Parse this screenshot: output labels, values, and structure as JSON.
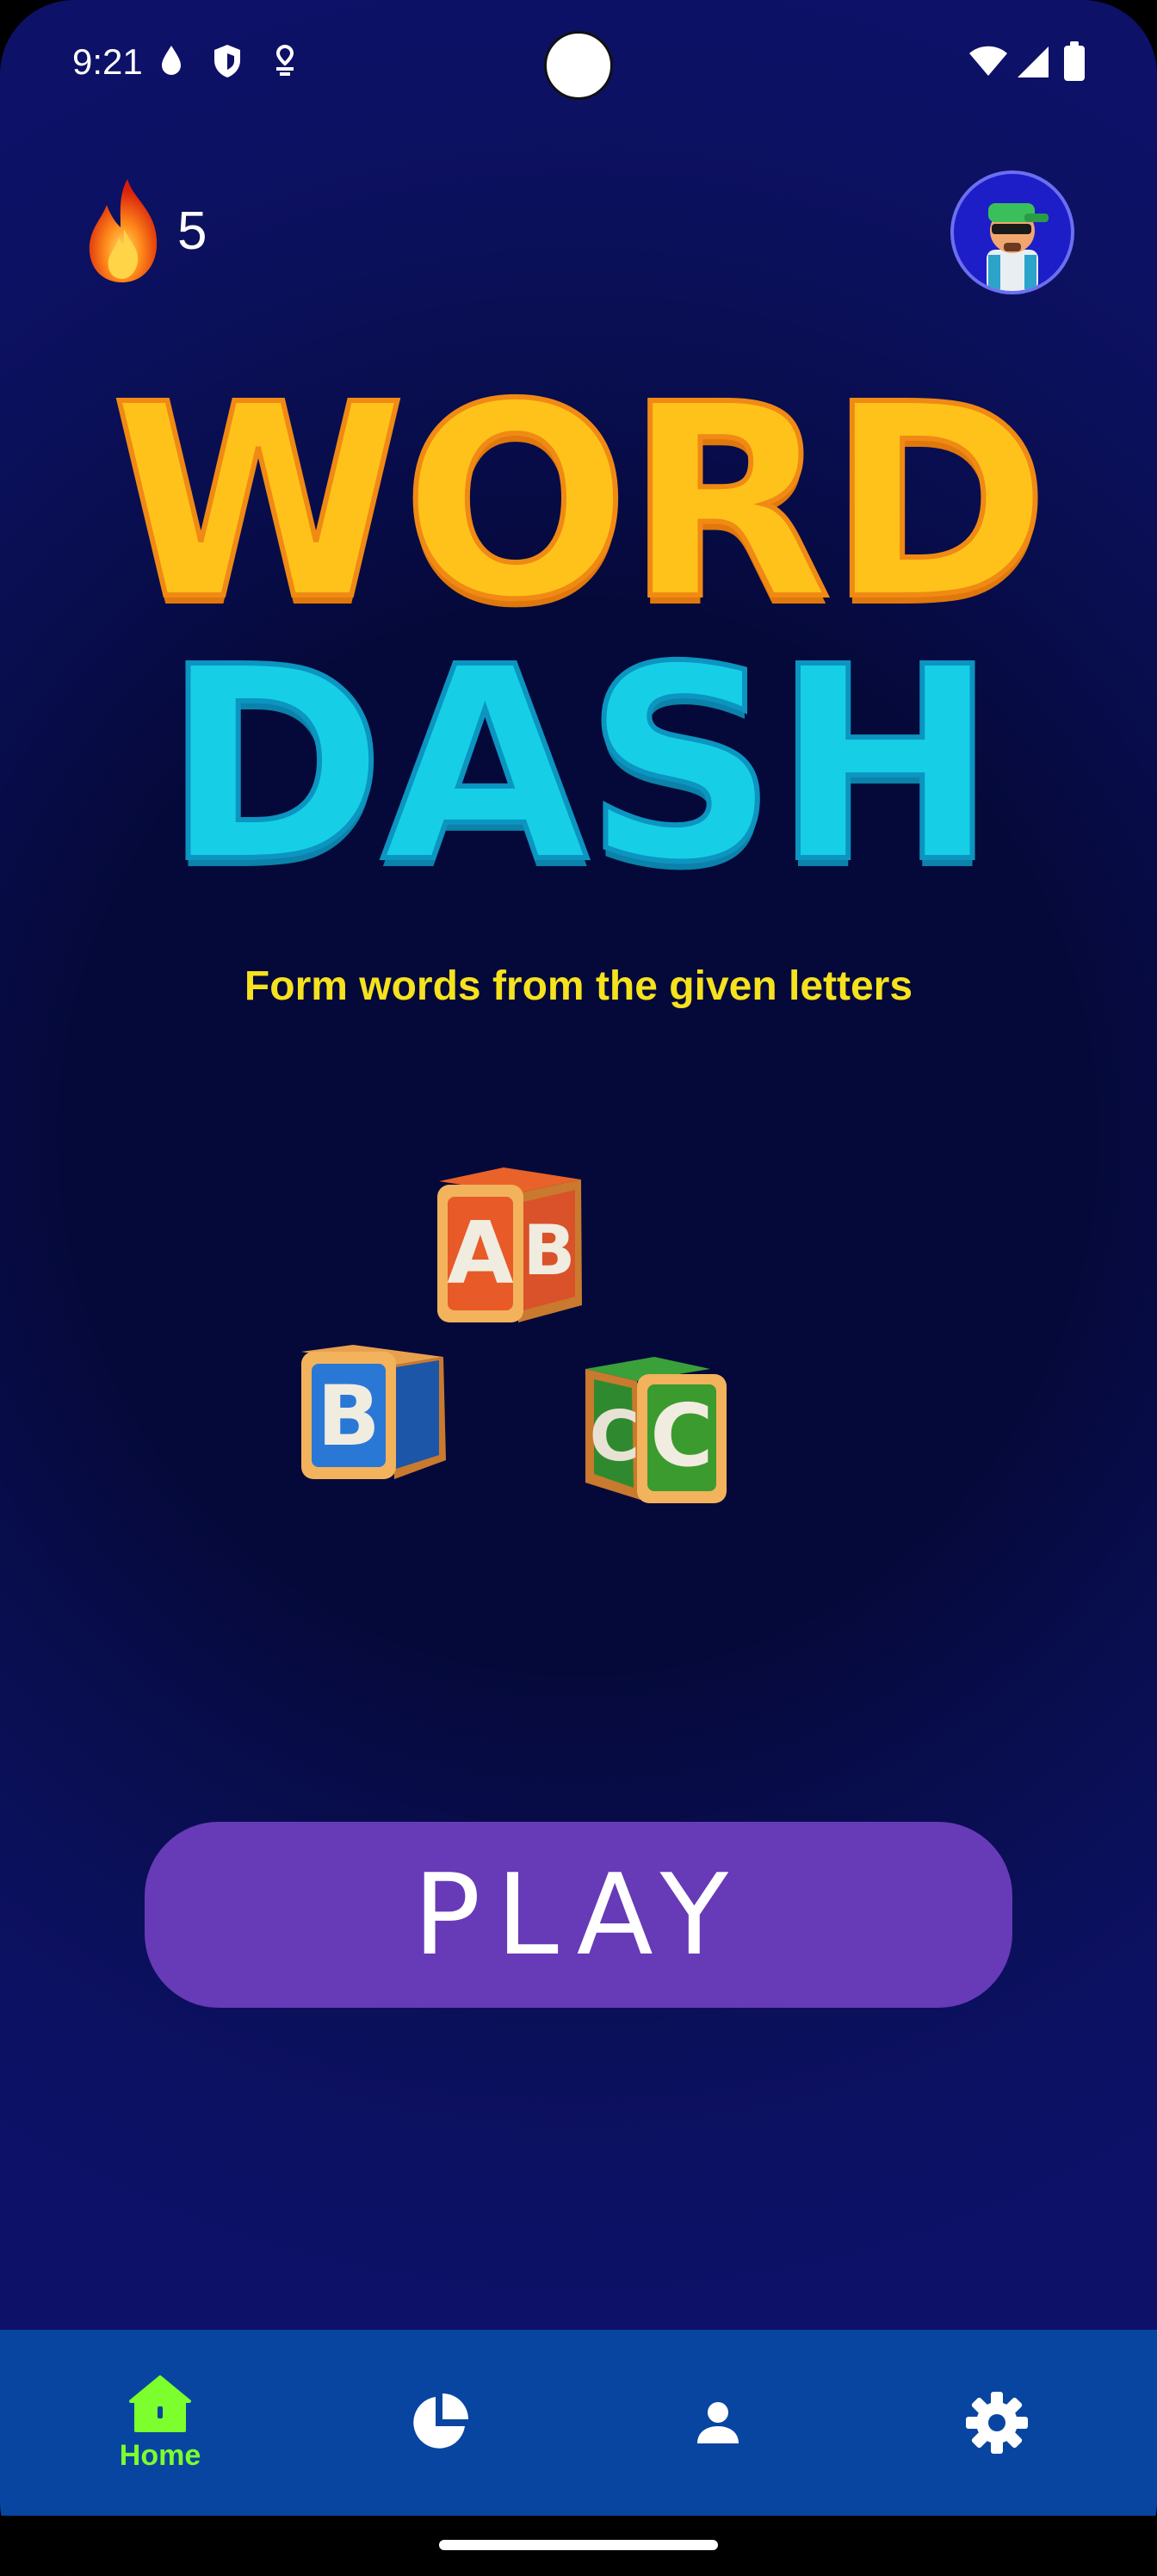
{
  "status_bar": {
    "time": "9:21",
    "left_icons": [
      "drop-icon",
      "shield-icon",
      "location-icon"
    ],
    "right_icons": [
      "wifi-icon",
      "signal-icon",
      "battery-icon"
    ]
  },
  "streak": {
    "count": "5",
    "icon": "flame-icon"
  },
  "title": {
    "line1": "WORD",
    "line2": "DASH"
  },
  "subtitle": "Form words from the given letters",
  "blocks": {
    "front_letters": [
      "A",
      "B",
      "C"
    ],
    "side_letters": [
      "B",
      "C"
    ]
  },
  "play_button": {
    "label": "PLAY"
  },
  "nav": {
    "items": [
      {
        "label": "Home",
        "icon": "home-icon",
        "active": true
      },
      {
        "label": "",
        "icon": "stats-pie-icon",
        "active": false
      },
      {
        "label": "",
        "icon": "profile-icon",
        "active": false
      },
      {
        "label": "",
        "icon": "settings-gear-icon",
        "active": false
      }
    ]
  },
  "colors": {
    "background": "#05093a",
    "title_word": "#ffc21a",
    "title_dash": "#16cfe6",
    "subtitle": "#f6e21d",
    "play_button": "#673ab7",
    "nav_bar": "#0845a0",
    "nav_active": "#7cff2c"
  }
}
